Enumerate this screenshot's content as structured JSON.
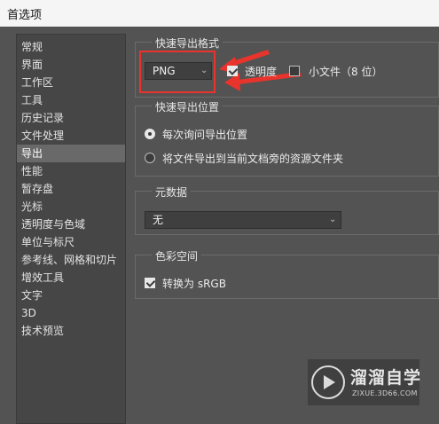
{
  "window": {
    "title": "首选项"
  },
  "sidebar": {
    "items": [
      {
        "label": "常规",
        "active": false
      },
      {
        "label": "界面",
        "active": false
      },
      {
        "label": "工作区",
        "active": false
      },
      {
        "label": "工具",
        "active": false
      },
      {
        "label": "历史记录",
        "active": false
      },
      {
        "label": "文件处理",
        "active": false
      },
      {
        "label": "导出",
        "active": true
      },
      {
        "label": "性能",
        "active": false
      },
      {
        "label": "暂存盘",
        "active": false
      },
      {
        "label": "光标",
        "active": false
      },
      {
        "label": "透明度与色域",
        "active": false
      },
      {
        "label": "单位与标尺",
        "active": false
      },
      {
        "label": "参考线、网格和切片",
        "active": false
      },
      {
        "label": "增效工具",
        "active": false
      },
      {
        "label": "文字",
        "active": false
      },
      {
        "label": "3D",
        "active": false
      },
      {
        "label": "技术预览",
        "active": false
      }
    ]
  },
  "quick_export_format": {
    "legend": "快速导出格式",
    "format_value": "PNG",
    "transparency_label": "透明度",
    "transparency_checked": true,
    "small_file_label": "小文件（8 位）",
    "small_file_checked": false
  },
  "quick_export_location": {
    "legend": "快速导出位置",
    "option_ask": "每次询问导出位置",
    "option_ask_selected": true,
    "option_next_to_doc": "将文件导出到当前文档旁的资源文件夹",
    "option_next_to_doc_selected": false
  },
  "metadata": {
    "legend": "元数据",
    "value": "无"
  },
  "color_space": {
    "legend": "色彩空间",
    "srgb_label": "转换为 sRGB",
    "srgb_checked": true
  },
  "annotation": {
    "color": "#e8342c"
  },
  "watermark": {
    "brand": "溜溜自学",
    "site": "ZIXUE.3D66.COM"
  }
}
